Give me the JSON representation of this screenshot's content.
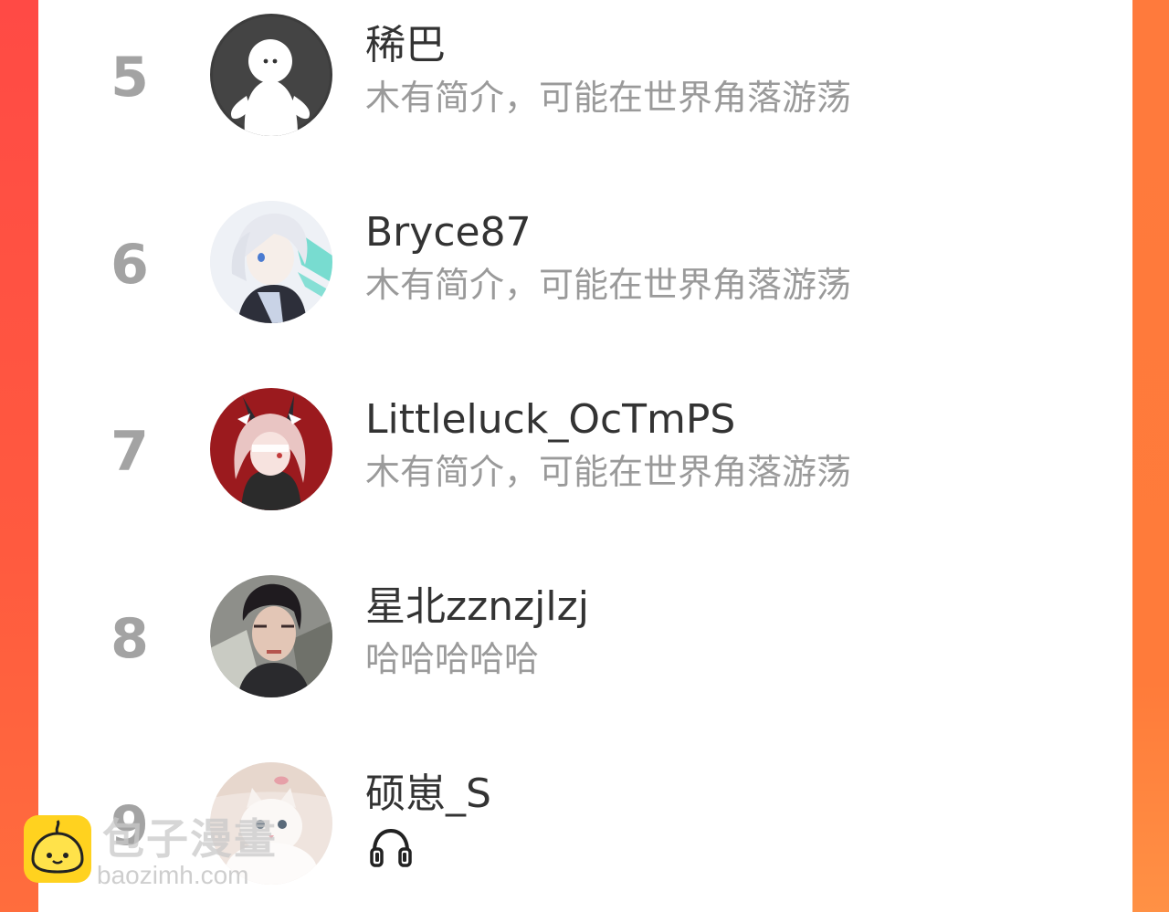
{
  "colors": {
    "accent_left": "#ff4a45",
    "accent_right": "#ff7b3a",
    "rank_text": "#a3a3a3",
    "username_text": "#333333",
    "bio_text": "#9a9a9a"
  },
  "ranking": {
    "entries": [
      {
        "rank": "5",
        "username": "稀巴",
        "bio": "木有简介，可能在世界角落游荡",
        "avatar": "default-avatar"
      },
      {
        "rank": "6",
        "username": "Bryce87",
        "bio": "木有简介，可能在世界角落游荡",
        "avatar": "anime-white-hair-avatar"
      },
      {
        "rank": "7",
        "username": "Littleluck_OcTmPS",
        "bio": "木有简介，可能在世界角落游荡",
        "avatar": "anime-bunny-ears-avatar"
      },
      {
        "rank": "8",
        "username": "星北zznzjlzj",
        "bio": "哈哈哈哈哈",
        "avatar": "photo-person-avatar"
      },
      {
        "rank": "9",
        "username": "硕崽_S",
        "bio_icon": "headphones-icon",
        "avatar": "white-cat-avatar"
      }
    ]
  },
  "watermark": {
    "title": "包子漫畫",
    "url": "baozimh.com"
  }
}
